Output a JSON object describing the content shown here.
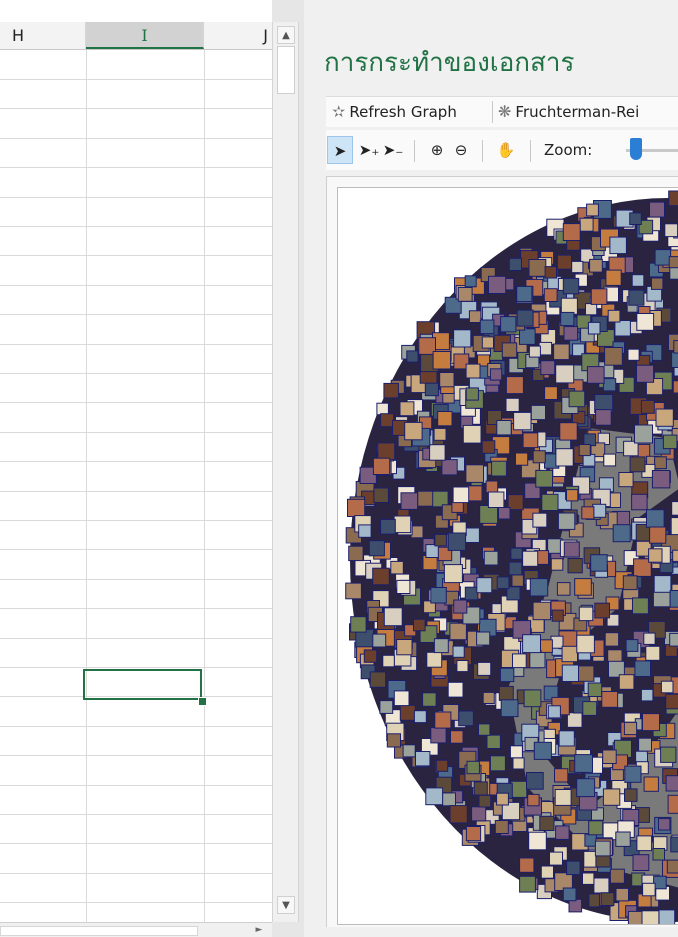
{
  "spreadsheet": {
    "columns": [
      "H",
      "I",
      "J"
    ],
    "selected_column": "I",
    "header_bg": "#f3f3f3",
    "accent": "#217346"
  },
  "scrollbar": {
    "up_icon": "▲",
    "down_icon": "▼",
    "right_icon": "►"
  },
  "panel": {
    "title": "การกระทำของเอกสาร",
    "title_color": "#217346",
    "toolbar": {
      "refresh_icon": "✫",
      "refresh_label": "Refresh Graph",
      "layout_icon": "❋",
      "layout_label": "Fruchterman-Rei"
    },
    "tools": {
      "pointer_icon": "➤",
      "add_select_icon": "➤₊",
      "remove_select_icon": "➤₋",
      "zoom_in_icon": "⊕",
      "zoom_out_icon": "⊖",
      "pan_icon": "✋",
      "zoom_label": "Zoom:"
    },
    "graph": {
      "node_count_visual": "dense",
      "hub_color": "#7a7a7a",
      "border_color": "#1b1f6b"
    }
  }
}
